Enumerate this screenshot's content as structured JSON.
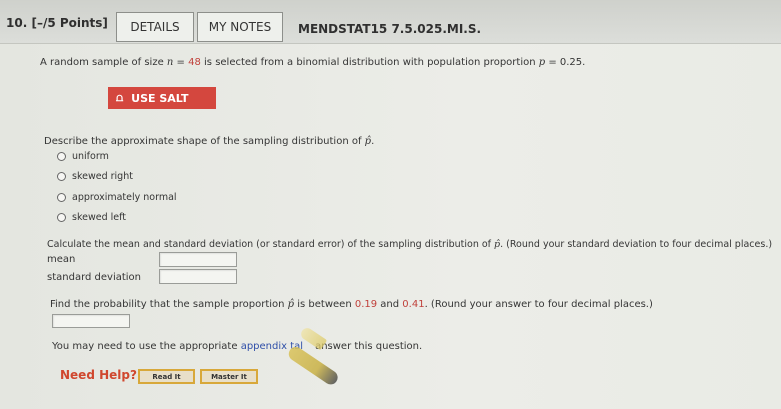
{
  "header": {
    "question_number": "10.",
    "points": "[–/5 Points]",
    "details_label": "DETAILS",
    "notes_label": "MY NOTES",
    "problem_code": "MENDSTAT15 7.5.025.MI.S."
  },
  "problem": {
    "intro_a": "A random sample of size ",
    "n_var": "n",
    "n_eq": " = ",
    "n_value": "48",
    "intro_b": " is selected from a binomial distribution with population proportion ",
    "p_var": "p",
    "p_eq": " = 0.25",
    "intro_end": "."
  },
  "salt_button": {
    "label": "USE SALT",
    "icon": "salt-icon"
  },
  "shape_question": {
    "prompt": "Describe the approximate shape of the sampling distribution of ",
    "phat": "p̂",
    "prompt_end": ".",
    "options": [
      "uniform",
      "skewed right",
      "approximately normal",
      "skewed left"
    ]
  },
  "mean_sd": {
    "prompt_a": "Calculate the mean and standard deviation (or standard error) of the sampling distribution of ",
    "phat": "p̂",
    "prompt_b": ". (Round your standard deviation to four decimal places.)",
    "mean_label": "mean",
    "sd_label": "standard deviation",
    "mean_value": "",
    "sd_value": ""
  },
  "probability": {
    "prompt_a": "Find the probability that the sample proportion ",
    "phat": "p̂",
    "prompt_b": " is between ",
    "low": "0.19",
    "and": " and ",
    "high": "0.41",
    "prompt_c": ". (Round your answer to four decimal places.)",
    "answer_value": ""
  },
  "appendix_note": {
    "a": "You may need to use the appropriate ",
    "link": "appendix tal",
    "b": "answer this question."
  },
  "help": {
    "need_help": "Need Help?",
    "read_it": "Read It",
    "master_it": "Master It"
  },
  "colors": {
    "salt_red": "#d4473e",
    "need_help_orange": "#d0472e",
    "value_red": "#c0413b",
    "link_blue": "#2f4fa8",
    "help_border_gold": "#d8a83a"
  }
}
